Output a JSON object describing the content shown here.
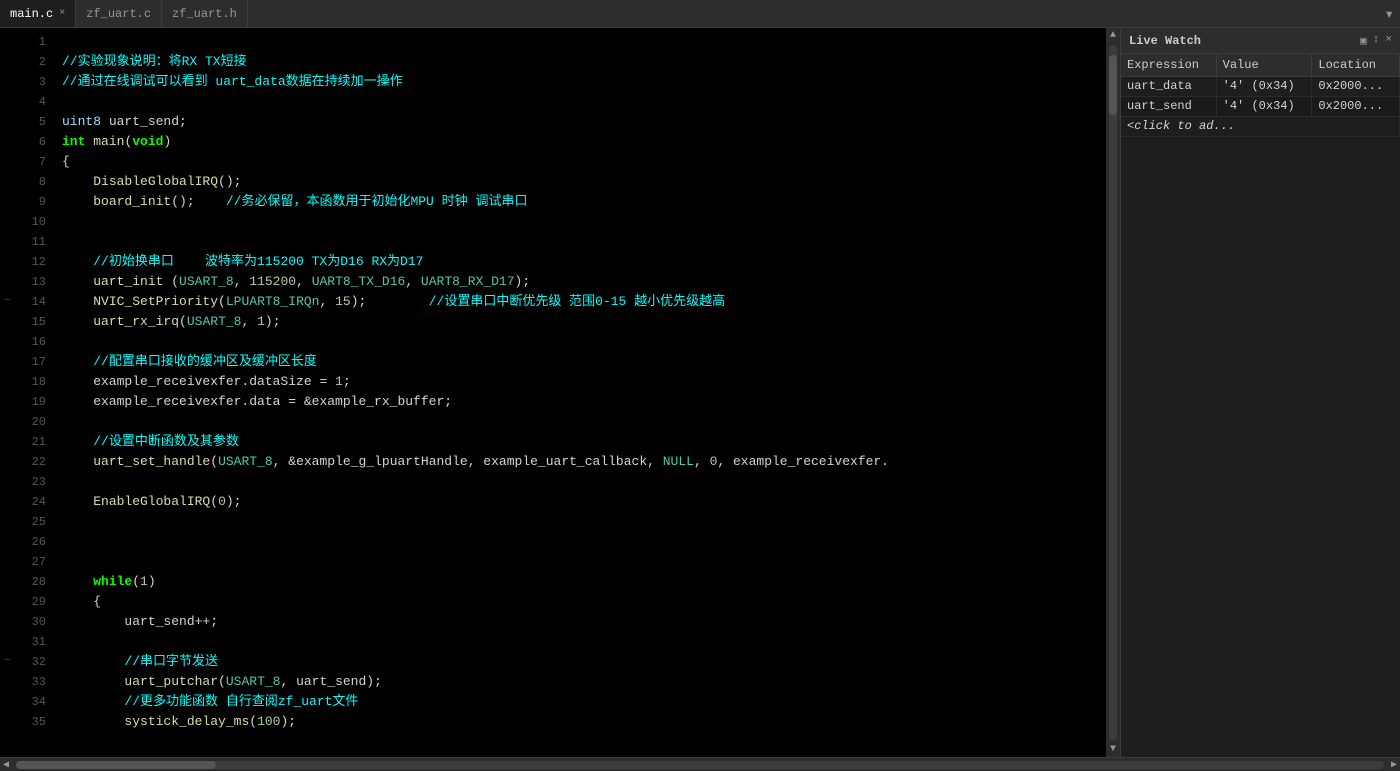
{
  "tabs": [
    {
      "label": "main.c",
      "active": true,
      "closable": true
    },
    {
      "label": "zf_uart.c",
      "active": false,
      "closable": false
    },
    {
      "label": "zf_uart.h",
      "active": false,
      "closable": false
    }
  ],
  "tabBarEnd": "▾",
  "liveWatch": {
    "title": "Live Watch",
    "controls": [
      "▣ ↕",
      "×"
    ],
    "columns": [
      "Expression",
      "Value",
      "Location"
    ],
    "rows": [
      {
        "expression": "uart_data",
        "value": "'4' (0x34)",
        "location": "0x2000..."
      },
      {
        "expression": "uart_send",
        "value": "'4' (0x34)",
        "location": "0x2000..."
      },
      {
        "expression": "<click to ad...",
        "value": "",
        "location": ""
      }
    ]
  },
  "code": {
    "lines": [
      "",
      "//实验现象说明：将RX TX短接",
      "//通过在线调试可以看到 uart_data数据在持续加一操作",
      "",
      "uint8 uart_send;",
      "int main(void)",
      "{",
      "    DisableGlobalIRQ();",
      "    board_init();    //务必保留，本函数用于初始化MPU 时钟 调试串口",
      "",
      "",
      "    //初始换串口    波特率为115200 TX为D16 RX为D17",
      "    uart_init (USART_8, 115200, UART8_TX_D16, UART8_RX_D17);",
      "    NVIC_SetPriority(LPUART8_IRQn, 15);        //设置串口中断优先级 范围0-15 越小优先级越高",
      "    uart_rx_irq(USART_8, 1);",
      "",
      "    //配置串口接收的缓冲区及缓冲区长度",
      "    example_receivexfer.dataSize = 1;",
      "    example_receivexfer.data = &example_rx_buffer;",
      "",
      "    //设置中断函数及其参数",
      "    uart_set_handle(USART_8, &example_g_lpuartHandle, example_uart_callback, NULL, 0, example_receivexfer.",
      "",
      "    EnableGlobalIRQ(0);",
      "",
      "",
      "",
      "    while(1)",
      "    {",
      "        uart_send++;",
      "",
      "        //串口字节发送",
      "        uart_putchar(USART_8, uart_send);",
      "        //更多功能函数 自行查阅zf_uart文件",
      "        systick_delay_ms(100);"
    ]
  }
}
